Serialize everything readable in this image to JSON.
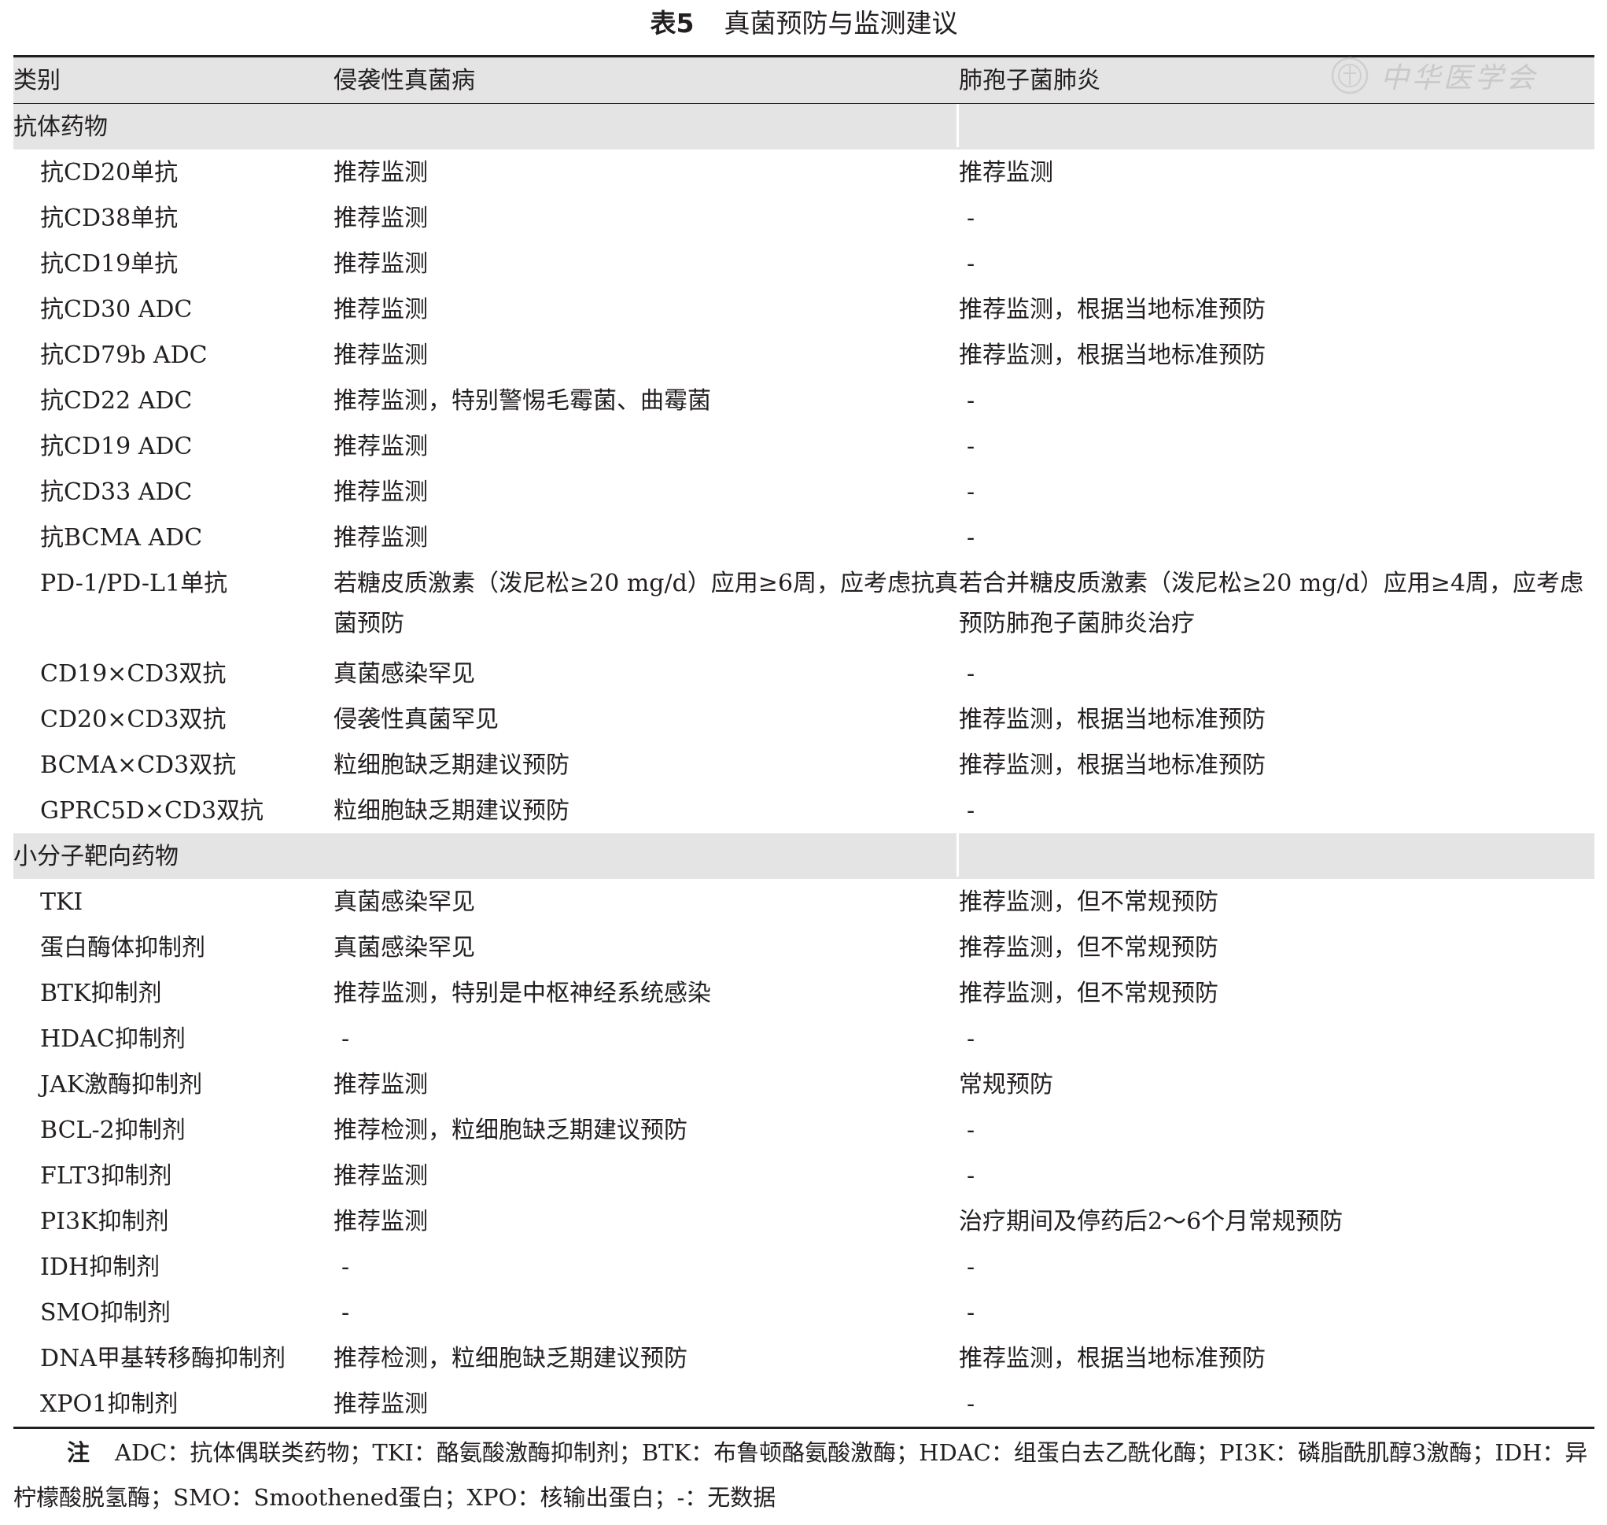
{
  "caption": {
    "number": "表5",
    "title": "真菌预防与监测建议"
  },
  "watermark": {
    "text": "中华医学会"
  },
  "header": [
    "类别",
    "侵袭性真菌病",
    "肺孢子菌肺炎"
  ],
  "sections": [
    {
      "title": "抗体药物",
      "rows": [
        [
          "抗CD20单抗",
          "推荐监测",
          "推荐监测"
        ],
        [
          "抗CD38单抗",
          "推荐监测",
          "-"
        ],
        [
          "抗CD19单抗",
          "推荐监测",
          "-"
        ],
        [
          "抗CD30 ADC",
          "推荐监测",
          "推荐监测，根据当地标准预防"
        ],
        [
          "抗CD79b ADC",
          "推荐监测",
          "推荐监测，根据当地标准预防"
        ],
        [
          "抗CD22 ADC",
          "推荐监测，特别警惕毛霉菌、曲霉菌",
          "-"
        ],
        [
          "抗CD19 ADC",
          "推荐监测",
          "-"
        ],
        [
          "抗CD33 ADC",
          "推荐监测",
          "-"
        ],
        [
          "抗BCMA ADC",
          "推荐监测",
          "-"
        ],
        [
          "PD-1/PD-L1单抗",
          "若糖皮质激素（泼尼松≥20 mg/d）应用≥6周，应考虑抗真菌预防",
          "若合并糖皮质激素（泼尼松≥20 mg/d）应用≥4周，应考虑预防肺孢子菌肺炎治疗"
        ],
        [
          "CD19×CD3双抗",
          "真菌感染罕见",
          "-"
        ],
        [
          "CD20×CD3双抗",
          "侵袭性真菌罕见",
          "推荐监测，根据当地标准预防"
        ],
        [
          "BCMA×CD3双抗",
          "粒细胞缺乏期建议预防",
          "推荐监测，根据当地标准预防"
        ],
        [
          "GPRC5D×CD3双抗",
          "粒细胞缺乏期建议预防",
          "-"
        ]
      ]
    },
    {
      "title": "小分子靶向药物",
      "rows": [
        [
          "TKI",
          "真菌感染罕见",
          "推荐监测，但不常规预防"
        ],
        [
          "蛋白酶体抑制剂",
          "真菌感染罕见",
          "推荐监测，但不常规预防"
        ],
        [
          "BTK抑制剂",
          "推荐监测，特别是中枢神经系统感染",
          "推荐监测，但不常规预防"
        ],
        [
          "HDAC抑制剂",
          "-",
          "-"
        ],
        [
          "JAK激酶抑制剂",
          "推荐监测",
          "常规预防"
        ],
        [
          "BCL-2抑制剂",
          "推荐检测，粒细胞缺乏期建议预防",
          "-"
        ],
        [
          "FLT3抑制剂",
          "推荐监测",
          "-"
        ],
        [
          "PI3K抑制剂",
          "推荐监测",
          "治疗期间及停药后2～6个月常规预防"
        ],
        [
          "IDH抑制剂",
          "-",
          "-"
        ],
        [
          "SMO抑制剂",
          "-",
          "-"
        ],
        [
          "DNA甲基转移酶抑制剂",
          "推荐检测，粒细胞缺乏期建议预防",
          "推荐监测，根据当地标准预防"
        ],
        [
          "XPO1抑制剂",
          "推荐监测",
          "-"
        ]
      ]
    }
  ],
  "note": {
    "label": "注",
    "text": "ADC：抗体偶联类药物；TKI：酪氨酸激酶抑制剂；BTK：布鲁顿酪氨酸激酶；HDAC：组蛋白去乙酰化酶；PI3K：磷脂酰肌醇3激酶；IDH：异柠檬酸脱氢酶；SMO：Smoothened蛋白；XPO：核输出蛋白；-：无数据"
  }
}
